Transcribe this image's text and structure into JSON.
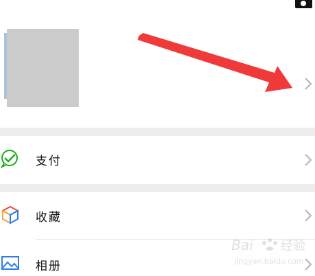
{
  "rows": [
    {
      "label": "支付",
      "icon": "wechat-pay-icon",
      "color": "#1aad19"
    },
    {
      "label": "收藏",
      "icon": "favorites-cube-icon",
      "color": "#f2a33a"
    },
    {
      "label": "相册",
      "icon": "album-icon",
      "color": "#2b7de9"
    }
  ],
  "colors": {
    "background": "#ffffff",
    "section_gap": "#ededed",
    "arrow": "#f03a3a",
    "avatar_placeholder": "#cbcbcb"
  },
  "watermark": {
    "text": "Bai 经验",
    "sub": "jingyan.baidu.com"
  }
}
